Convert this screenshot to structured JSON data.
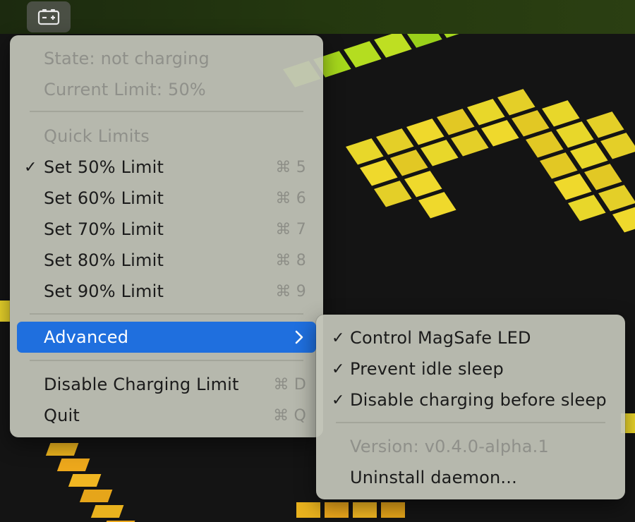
{
  "menubar": {
    "status_icon": "battery-charging-icon"
  },
  "main_menu": {
    "state": "State: not charging",
    "current_limit": "Current Limit: 50%",
    "quick_limits_header": "Quick Limits",
    "items": [
      {
        "label": "Set 50% Limit",
        "shortcut": "⌘ 5",
        "checked": true
      },
      {
        "label": "Set 60% Limit",
        "shortcut": "⌘ 6",
        "checked": false
      },
      {
        "label": "Set 70% Limit",
        "shortcut": "⌘ 7",
        "checked": false
      },
      {
        "label": "Set 80% Limit",
        "shortcut": "⌘ 8",
        "checked": false
      },
      {
        "label": "Set 90% Limit",
        "shortcut": "⌘ 9",
        "checked": false
      }
    ],
    "advanced": "Advanced",
    "disable_charging_limit": {
      "label": "Disable Charging Limit",
      "shortcut": "⌘ D"
    },
    "quit": {
      "label": "Quit",
      "shortcut": "⌘ Q"
    },
    "checkmark": "✓"
  },
  "sub_menu": {
    "items": [
      {
        "label": "Control MagSafe LED",
        "checked": true
      },
      {
        "label": "Prevent idle sleep",
        "checked": true
      },
      {
        "label": "Disable charging before sleep",
        "checked": true
      }
    ],
    "version": "Version: v0.4.0-alpha.1",
    "uninstall": "Uninstall daemon..."
  },
  "colors": {
    "accent": "#1f6fde",
    "menu_bg": "#c3c5b9",
    "disabled_text": "#8f908a"
  }
}
